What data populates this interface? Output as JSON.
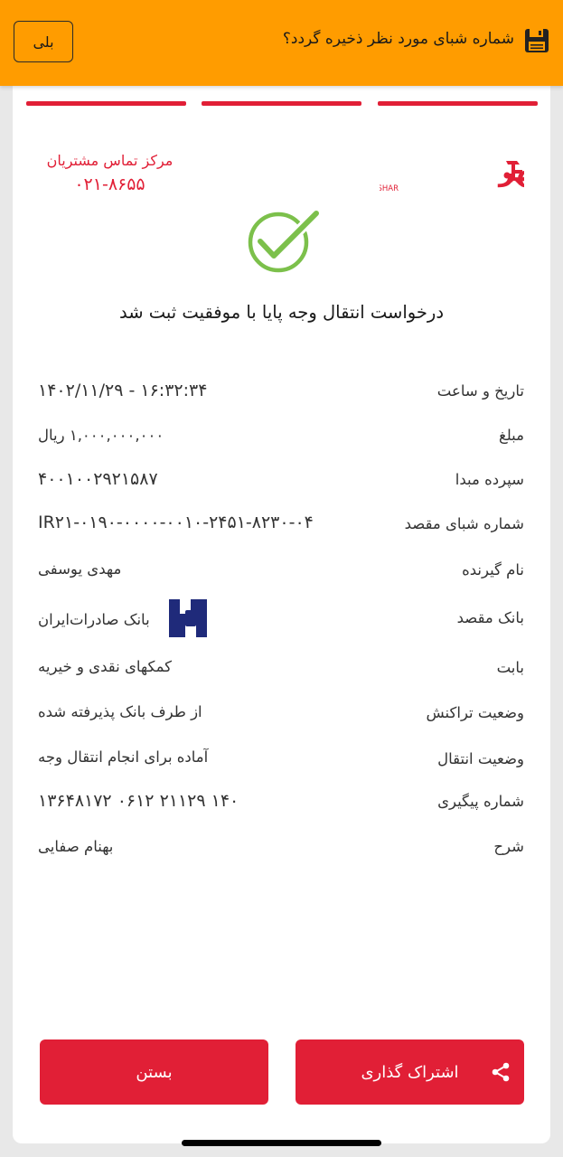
{
  "banner": {
    "message": "شماره شبای مورد نظر ذخیره گردد؟",
    "yes_label": "بلی",
    "icon": "save-icon",
    "color": "#ff9c00"
  },
  "brand": {
    "logo_text": "بانک شهر",
    "logo_latin": "BANK SHAR",
    "color": "#e11f36"
  },
  "contact": {
    "label": "مرکز تماس مشتریان",
    "phone": "۰۲۱-۸۶۵۵"
  },
  "status": {
    "message": "درخواست انتقال وجه پایا با موفقیت  ثبت شد",
    "icon": "success-check-icon",
    "color": "#7cc04b"
  },
  "details": {
    "datetime": {
      "label": "تاریخ و ساعت",
      "value": "۱۶:۳۲:۳۴  -  ۱۴۰۲/۱۱/۲۹"
    },
    "amount": {
      "label": "مبلغ",
      "value": "۱,۰۰۰,۰۰۰,۰۰۰ ریال"
    },
    "source": {
      "label": "سپرده مبدا",
      "value": "۴۰۰۱۰۰۲۹۲۱۵۸۷"
    },
    "sheba": {
      "label": "شماره شبای مقصد",
      "value": "IR۲۱-۰۱۹۰-۰۰۰۰-۰۰۱۰-۲۴۵۱-۸۲۳۰-۰۴"
    },
    "receiver": {
      "label": "نام گیرنده",
      "value": "مهدی یوسفی"
    },
    "bank": {
      "label": "بانک مقصد",
      "value": "بانک صادرات‌ایران",
      "icon": "saderat-bank-logo"
    },
    "purpose": {
      "label": "بابت",
      "value": "کمکهای نقدی و خیریه"
    },
    "tx_status": {
      "label": "وضعیت تراکنش",
      "value": "از  طرف بانک پذیرفته شده"
    },
    "transfer_status": {
      "label": "وضعیت  انتقال",
      "value": "آماده  برای انجام انتقال وجه"
    },
    "tracking": {
      "label": "شماره  پیگیری",
      "value": "۱۴۰ ۲۱۱۲۹ ۰۶۱۲ ۱۳۶۴۸۱۷۲"
    },
    "description": {
      "label": "شرح",
      "value": "بهنام صفایی"
    }
  },
  "actions": {
    "share_label": "اشتراک گذاری",
    "share_icon": "share-icon",
    "close_label": "بستن"
  }
}
